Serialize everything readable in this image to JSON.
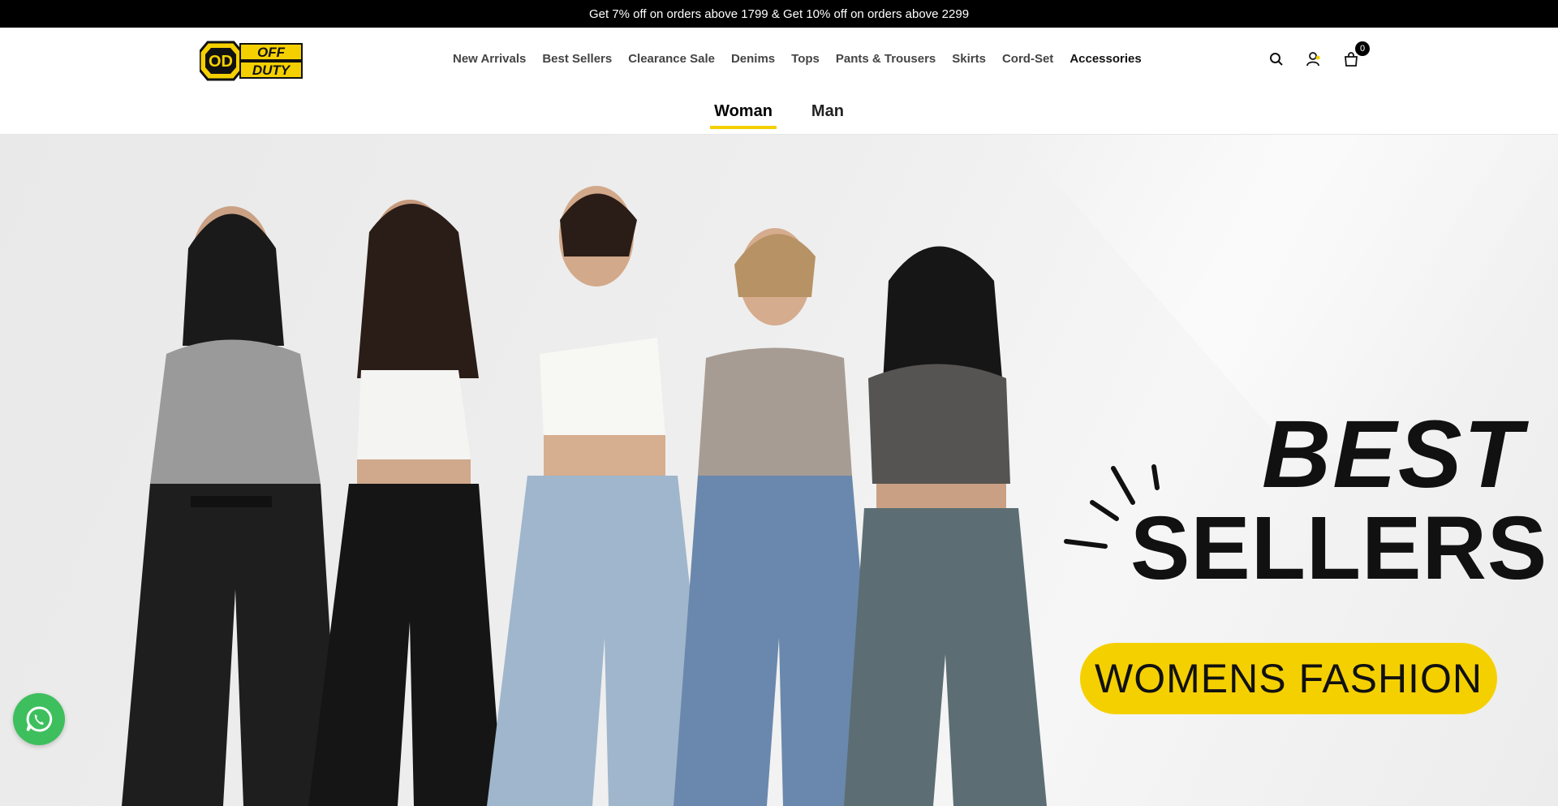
{
  "announcement": "Get 7% off on orders above 1799 & Get 10% off on orders above 2299",
  "logo": {
    "line1": "OFF",
    "line2": "DUTY",
    "mark": "OD"
  },
  "nav": [
    {
      "label": "New Arrivals"
    },
    {
      "label": "Best Sellers"
    },
    {
      "label": "Clearance Sale"
    },
    {
      "label": "Denims"
    },
    {
      "label": "Tops"
    },
    {
      "label": "Pants & Trousers"
    },
    {
      "label": "Skirts"
    },
    {
      "label": "Cord-Set"
    },
    {
      "label": "Accessories"
    }
  ],
  "icons": {
    "search": "search-icon",
    "account": "user-icon",
    "cart": "bag-icon"
  },
  "cart_count": "0",
  "gender_tabs": [
    {
      "label": "Woman",
      "active": true
    },
    {
      "label": "Man",
      "active": false
    }
  ],
  "hero": {
    "headline_1": "BEST",
    "headline_2": "SELLERS",
    "pill": "WOMENS FASHION"
  },
  "colors": {
    "accent": "#f5d000",
    "whatsapp": "#3dbf5d",
    "bar": "#000000"
  }
}
